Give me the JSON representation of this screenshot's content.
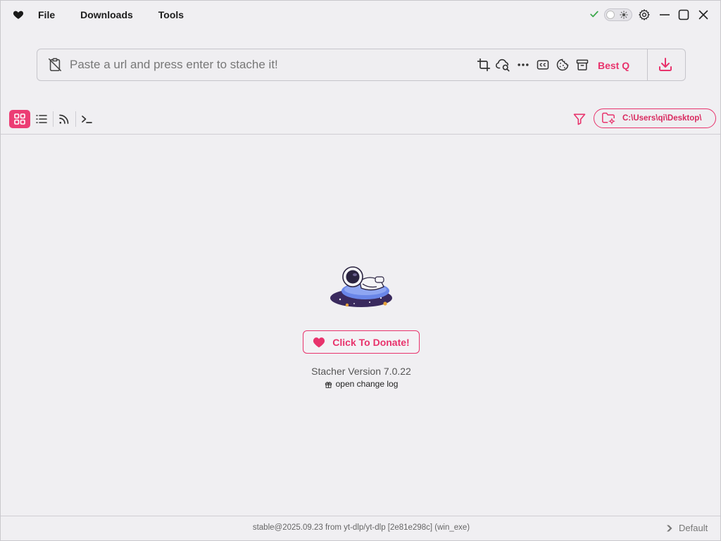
{
  "menu": {
    "file": "File",
    "downloads": "Downloads",
    "tools": "Tools"
  },
  "url_bar": {
    "placeholder": "Paste a url and press enter to stache it!",
    "value": "",
    "quality_label": "Best Q"
  },
  "toolbar": {
    "output_folder": "C:\\Users\\qi\\Desktop\\"
  },
  "center": {
    "donate_label": "Click To Donate!",
    "version": "Stacher Version 7.0.22",
    "changelog_link": "open change log"
  },
  "status": {
    "backend": "stable@2025.09.23 from yt-dlp/yt-dlp [2e81e298c] (win_exe)",
    "profile": "Default"
  },
  "colors": {
    "accent": "#e8336c",
    "background": "#f0eff2",
    "success": "#3aa84a"
  },
  "view": {
    "active": "grid"
  }
}
